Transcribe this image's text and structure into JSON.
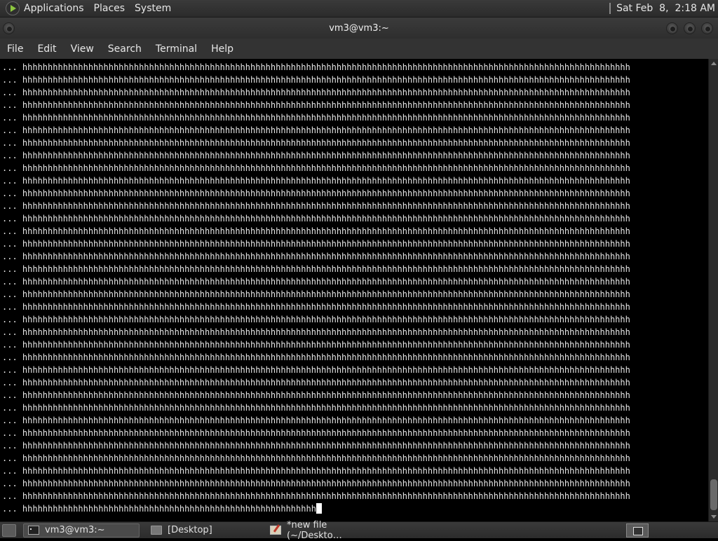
{
  "top_panel": {
    "menus": [
      "Applications",
      "Places",
      "System"
    ],
    "clock": "Sat Feb  8,  2:18 AM"
  },
  "window": {
    "title": "vm3@vm3:~"
  },
  "menubar": {
    "items": [
      "File",
      "Edit",
      "View",
      "Search",
      "Terminal",
      "Help"
    ]
  },
  "terminal": {
    "prompt": "...",
    "full_line": "hhhhhhhhhhhhhhhhhhhhhhhhhhhhhhhhhhhhhhhhhhhhhhhhhhhhhhhhhhhhhhhhhhhhhhhhhhhhhhhhhhhhhhhhhhhhhhhhhhhhhhhhhhhhhhhhhhhhhhhh",
    "full_line_count": 35,
    "last_line": "hhhhhhhhhhhhhhhhhhhhhhhhhhhhhhhhhhhhhhhhhhhhhhhhhhhhhhhhhh"
  },
  "taskbar": {
    "tasks": [
      {
        "label": "vm3@vm3:~",
        "icon": "terminal-icon",
        "active": true
      },
      {
        "label": "[Desktop]",
        "icon": "folder-icon",
        "active": false
      },
      {
        "label": "*new file (~/Deskto…",
        "icon": "text-editor-icon",
        "active": false
      }
    ]
  }
}
